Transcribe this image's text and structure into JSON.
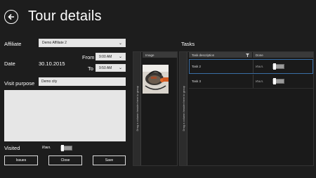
{
  "header": {
    "title": "Tour details",
    "back_icon": "arrow-left-circle-icon"
  },
  "form": {
    "affiliate_label": "Affiliate",
    "affiliate_value": "Demo Affiliate 2",
    "date_label": "Date",
    "date_value": "30.10.2015",
    "from_label": "From",
    "from_value": "9:00 AM",
    "to_label": "To",
    "to_value": "9:50 AM",
    "visit_purpose_label": "Visit purpose",
    "visit_purpose_value": "Demo city",
    "notes_value": "",
    "visited_label": "Visited",
    "visited_toggle_text": "Изкл.",
    "visited_on": false
  },
  "buttons": {
    "issues": "Issues",
    "close": "Close",
    "save": "Save"
  },
  "image_grid": {
    "group_hint": "Drag a column header here to group",
    "column": "Image"
  },
  "tasks": {
    "title": "Tasks",
    "group_hint": "Drag a column header here to group",
    "columns": [
      "Task description",
      "Done"
    ],
    "rows": [
      {
        "description": "Task 2",
        "done_text": "Изкл.",
        "done": false,
        "selected": true
      },
      {
        "description": "Task 3",
        "done_text": "Изкл.",
        "done": false,
        "selected": false
      }
    ]
  },
  "colors": {
    "background": "#1d1d1d",
    "field": "#e6e6e6",
    "selection": "#3a6ea5"
  }
}
